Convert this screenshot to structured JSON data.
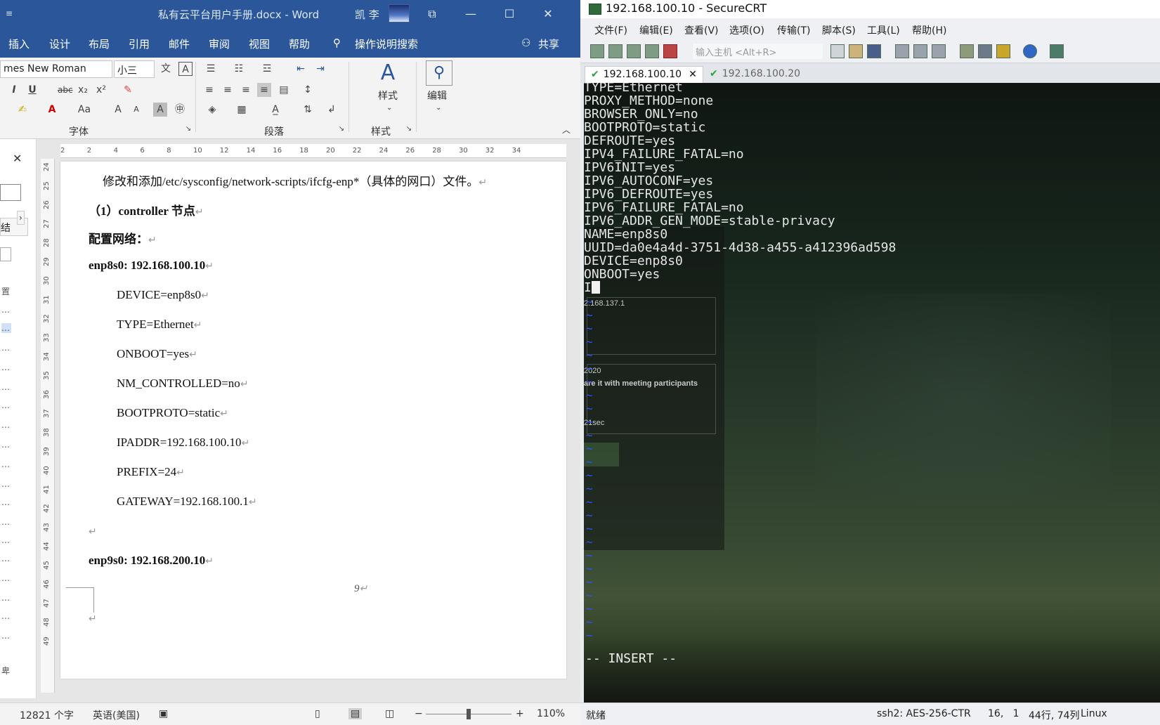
{
  "word": {
    "quick_access": "≡",
    "title": "私有云平台用户手册.docx - Word",
    "user": "凯 李",
    "menu": [
      "插入",
      "设计",
      "布局",
      "引用",
      "邮件",
      "审阅",
      "视图",
      "帮助"
    ],
    "tell_me": "操作说明搜索",
    "share": "共享",
    "ribbon": {
      "font_name": "mes New Roman",
      "font_size": "小三",
      "group_font": "字体",
      "group_paragraph": "段落",
      "group_styles": "样式",
      "styles_btn": "样式",
      "edit_btn": "编辑"
    },
    "left_pane": {
      "close": "✕",
      "tab_label": "结",
      "items": [
        "置",
        "…",
        "…",
        "…",
        "…",
        "…",
        "…",
        "…",
        "…",
        "…",
        "…",
        "…",
        "…",
        "…",
        "…",
        "…",
        "…",
        "…",
        "…",
        "卑"
      ]
    },
    "hruler": [
      "2",
      "2",
      "4",
      "6",
      "8",
      "10",
      "12",
      "14",
      "16",
      "18",
      "20",
      "22",
      "24",
      "26",
      "28",
      "30",
      "32",
      "34"
    ],
    "vruler": [
      "24",
      "25",
      "26",
      "27",
      "28",
      "29",
      "30",
      "31",
      "32",
      "33",
      "34",
      "35",
      "36",
      "37",
      "38",
      "39",
      "40",
      "41",
      "42",
      "43",
      "44",
      "45",
      "46",
      "47",
      "48",
      "49"
    ],
    "doc": {
      "p1": "修改和添加/etc/sysconfig/network-scripts/ifcfg-enp*（具体的网口）文件。",
      "p2": "（1）controller 节点",
      "p3": "配置网络：",
      "p4": "enp8s0: 192.168.100.10",
      "config": [
        "DEVICE=enp8s0",
        "TYPE=Ethernet",
        "ONBOOT=yes",
        "NM_CONTROLLED=no",
        "BOOTPROTO=static",
        "IPADDR=192.168.100.10",
        "PREFIX=24",
        "GATEWAY=192.168.100.1"
      ],
      "p5": "enp9s0: 192.168.200.10",
      "page_number": "9",
      "para_mark": "↵"
    },
    "status": {
      "word_count": "12821 个字",
      "language": "英语(美国)",
      "zoom": "110%"
    }
  },
  "crt": {
    "title": "192.168.100.10 - SecureCRT",
    "menu": [
      "文件(F)",
      "编辑(E)",
      "查看(V)",
      "选项(O)",
      "传输(T)",
      "脚本(S)",
      "工具(L)",
      "帮助(H)"
    ],
    "host_placeholder": "输入主机 <Alt+R>",
    "tabs": [
      {
        "label": "192.168.100.10",
        "active": true
      },
      {
        "label": "192.168.100.20",
        "active": false
      }
    ],
    "terminal_lines": [
      "TYPE=Ethernet",
      "PROXY_METHOD=none",
      "BROWSER_ONLY=no",
      "BOOTPROTO=static",
      "DEFROUTE=yes",
      "IPV4_FAILURE_FATAL=no",
      "IPV6INIT=yes",
      "IPV6_AUTOCONF=yes",
      "IPV6_DEFROUTE=yes",
      "IPV6_FAILURE_FATAL=no",
      "IPV6_ADDR_GEN_MODE=stable-privacy",
      "NAME=enp8s0",
      "UUID=da0e4a4d-3751-4d38-a455-a412396ad598",
      "DEVICE=enp8s0",
      "ONBOOT=yes",
      "I"
    ],
    "ghost": {
      "ip": "2.168.137.1",
      "year": "2020",
      "share": "are it with meeting participants",
      "sec": "21sec"
    },
    "mode": "-- INSERT --",
    "status": {
      "ready": "就绪",
      "cipher": "ssh2: AES-256-CTR",
      "pos": "16,   1",
      "size": "44行, 74列",
      "os": "Linux"
    }
  }
}
